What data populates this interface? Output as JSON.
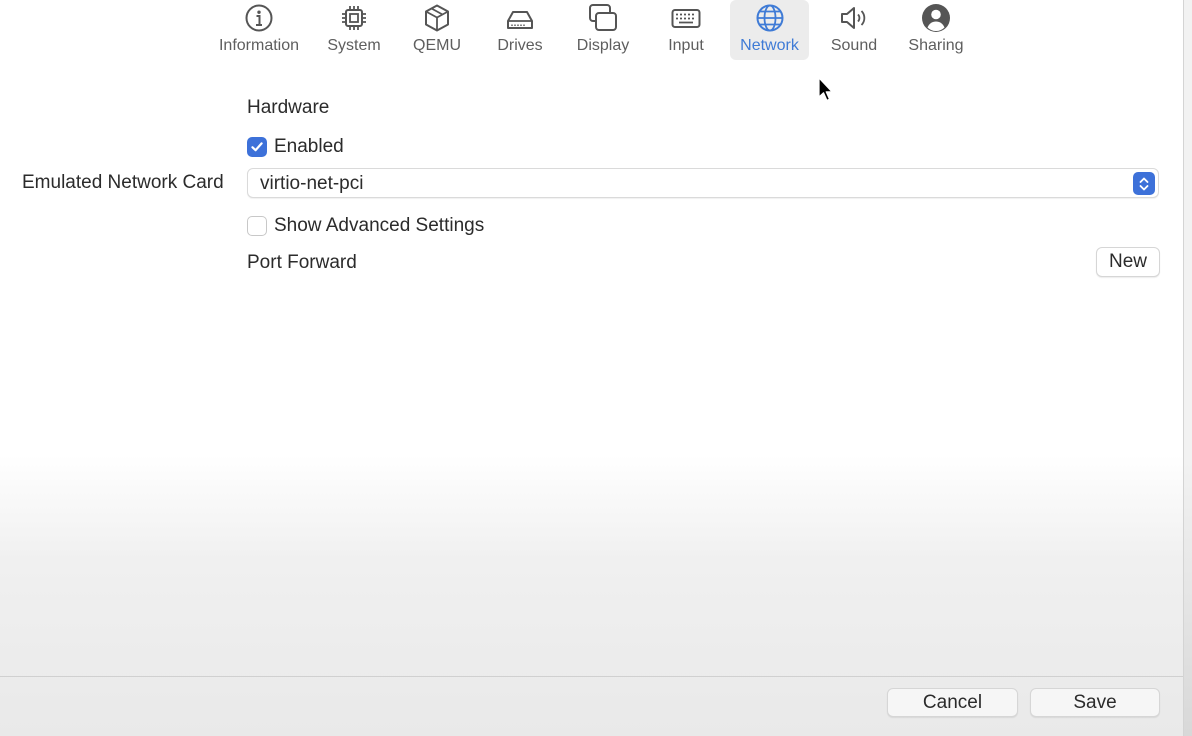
{
  "toolbar": {
    "items": [
      {
        "label": "Information",
        "icon": "info-icon"
      },
      {
        "label": "System",
        "icon": "cpu-icon"
      },
      {
        "label": "QEMU",
        "icon": "cube-icon"
      },
      {
        "label": "Drives",
        "icon": "drive-icon"
      },
      {
        "label": "Display",
        "icon": "display-icon"
      },
      {
        "label": "Input",
        "icon": "keyboard-icon"
      },
      {
        "label": "Network",
        "icon": "globe-icon",
        "selected": true
      },
      {
        "label": "Sound",
        "icon": "speaker-icon"
      },
      {
        "label": "Sharing",
        "icon": "person-icon"
      }
    ]
  },
  "network": {
    "hardware_title": "Hardware",
    "enabled_label": "Enabled",
    "enabled_checked": true,
    "card_label": "Emulated Network Card",
    "card_value": "virtio-net-pci",
    "advanced_label": "Show Advanced Settings",
    "advanced_checked": false,
    "port_forward_label": "Port Forward",
    "new_button": "New"
  },
  "footer": {
    "cancel": "Cancel",
    "save": "Save"
  },
  "colors": {
    "accent": "#3d71d9",
    "selected_tab_text": "#3f7bd6"
  }
}
